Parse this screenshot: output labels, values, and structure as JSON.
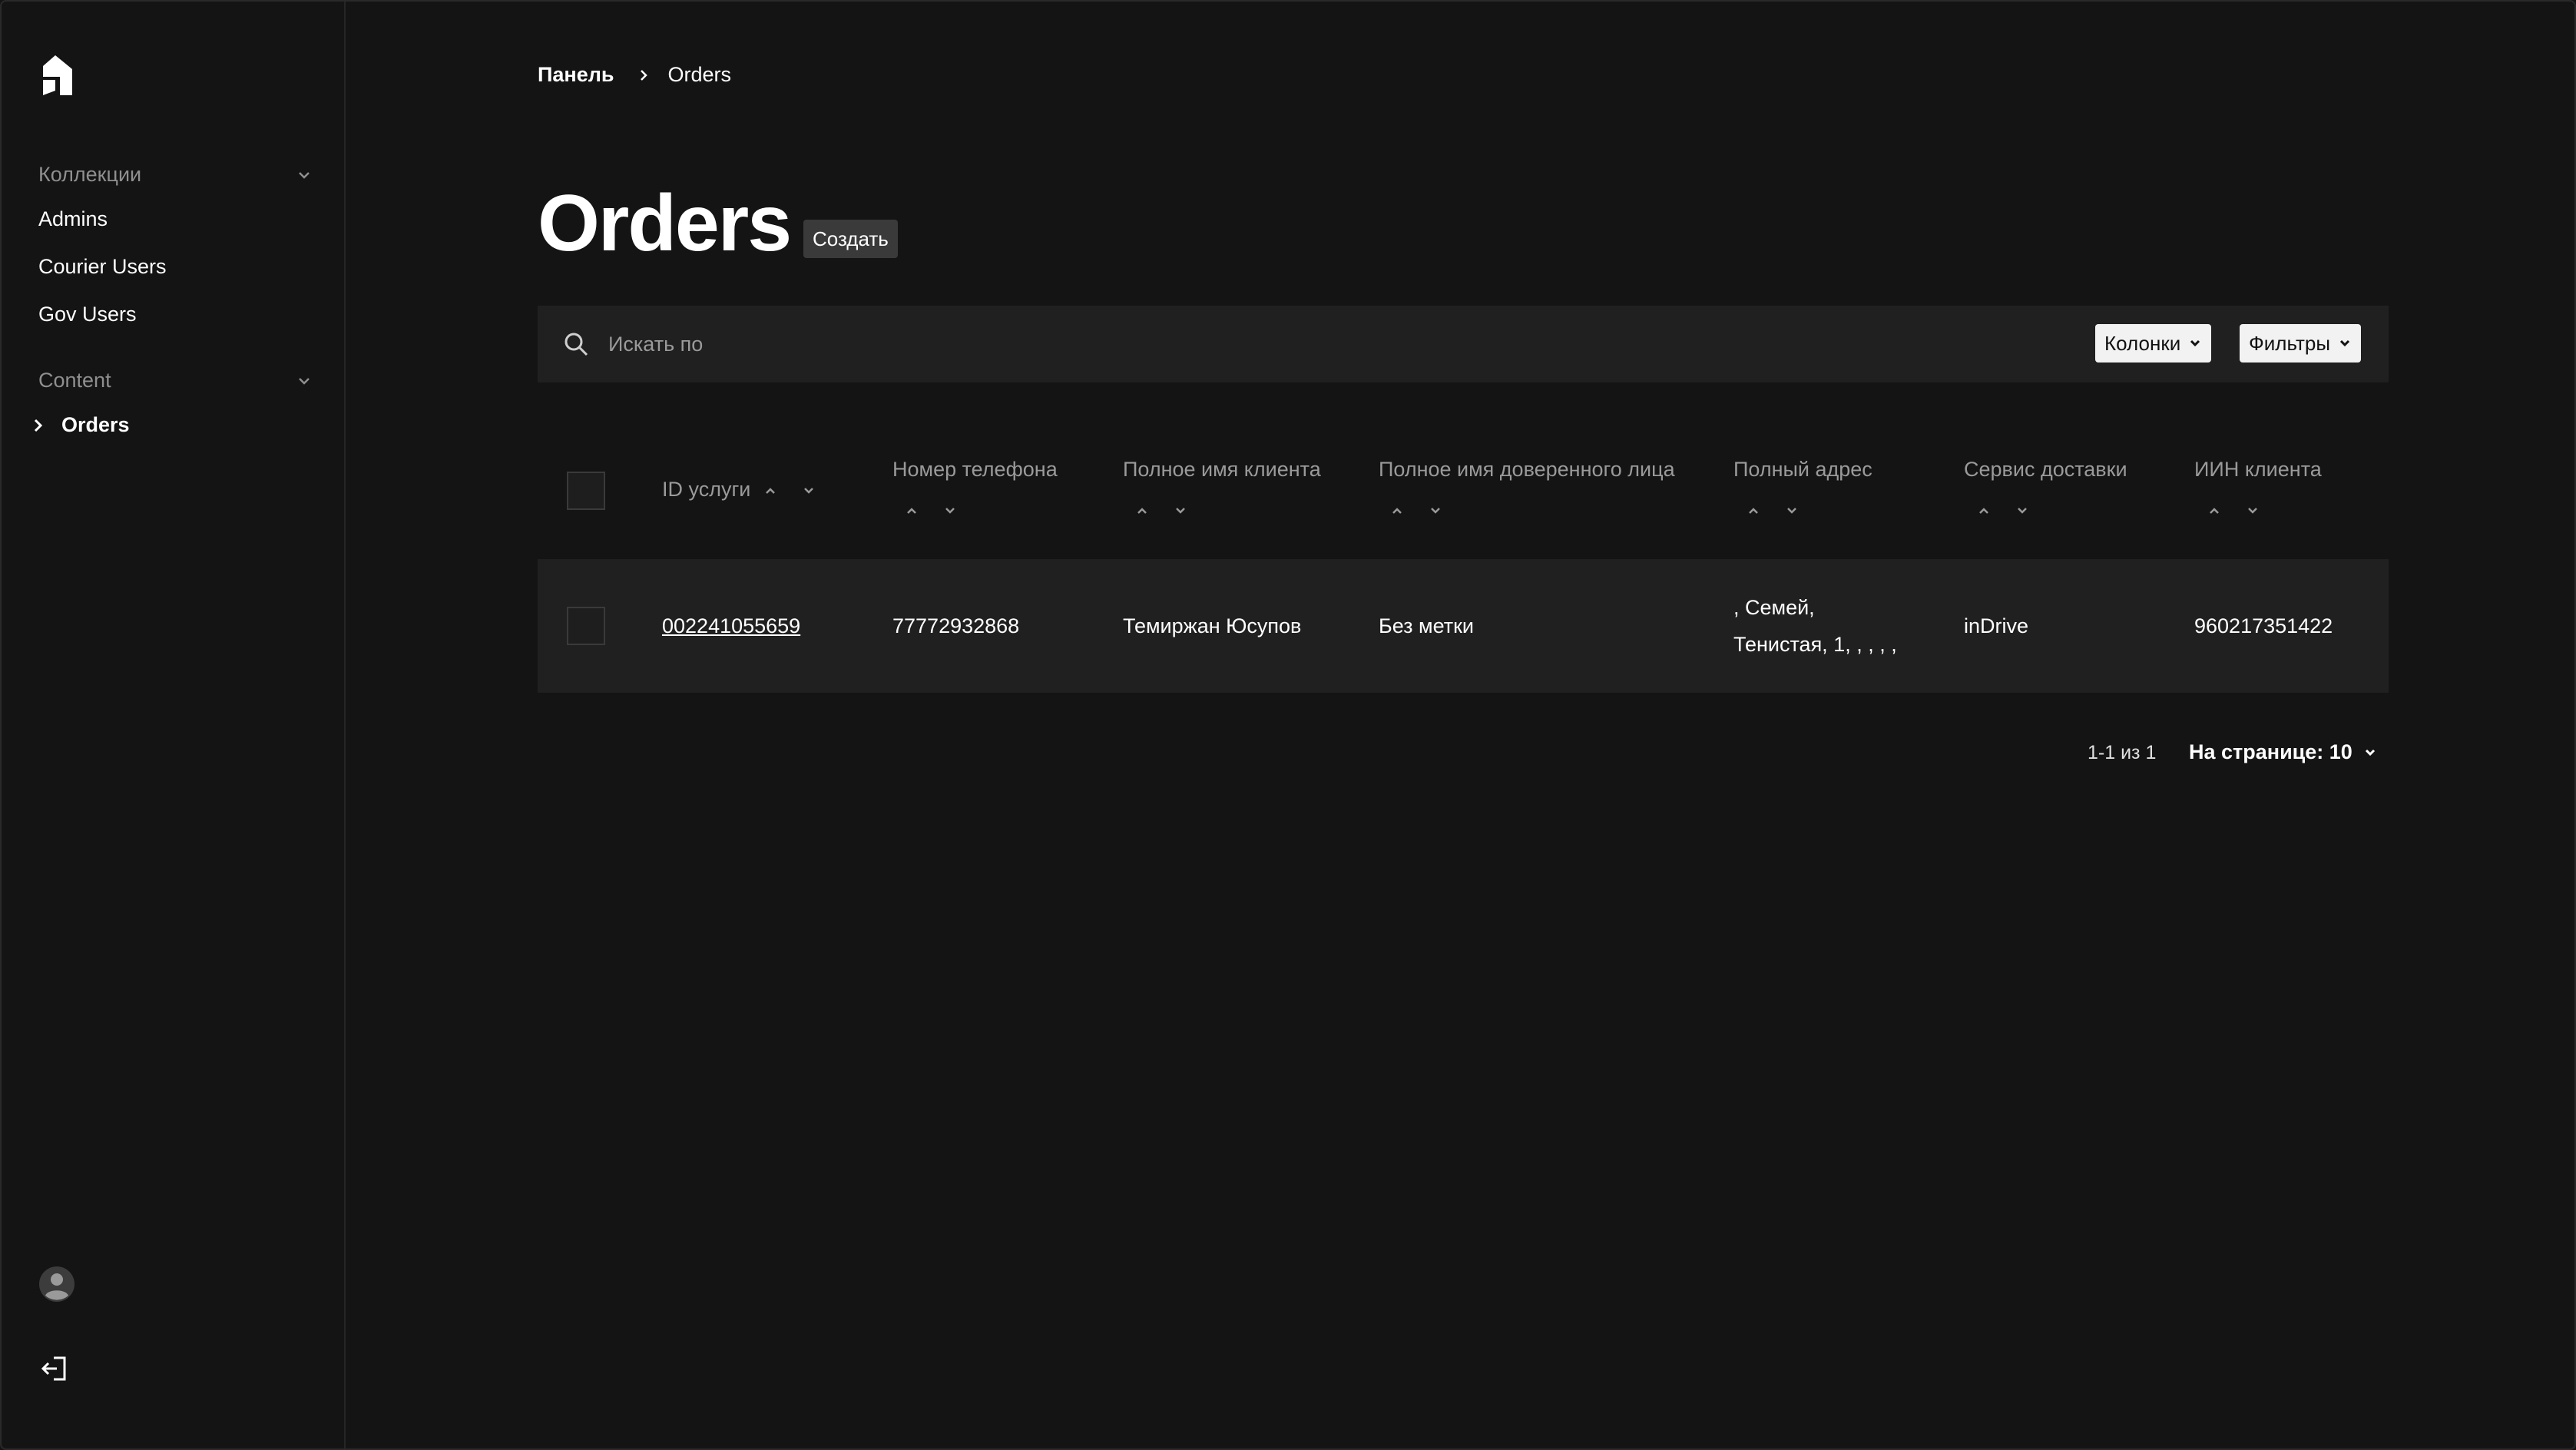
{
  "sidebar": {
    "collections_label": "Коллекции",
    "collections": [
      {
        "label": "Admins"
      },
      {
        "label": "Courier Users"
      },
      {
        "label": "Gov Users"
      }
    ],
    "content_label": "Content",
    "content_items": [
      {
        "label": "Orders",
        "active": true
      }
    ]
  },
  "breadcrumb": {
    "home": "Панель",
    "current": "Orders"
  },
  "page": {
    "title": "Orders",
    "create_label": "Создать"
  },
  "search": {
    "placeholder": "Искать по",
    "columns_label": "Колонки",
    "filters_label": "Фильтры"
  },
  "table": {
    "headers": [
      "ID услуги",
      "Номер телефона",
      "Полное имя клиента",
      "Полное имя доверенного лица",
      "Полный адрес",
      "Сервис доставки",
      "ИИН клиента"
    ],
    "rows": [
      {
        "id": "002241055659",
        "phone": "77772932868",
        "client_name": "Темиржан Юсупов",
        "proxy_name": "Без метки",
        "address_line1": ", Семей,",
        "address_line2": "Тенистая, 1, , , , ,",
        "delivery": "inDrive",
        "iin": "960217351422"
      }
    ]
  },
  "pagination": {
    "range": "1-1 из 1",
    "per_page": "На странице: 10"
  },
  "colors": {
    "background": "#141414",
    "panel": "#202020",
    "text": "#ffffff",
    "muted": "#9a9a9a"
  }
}
